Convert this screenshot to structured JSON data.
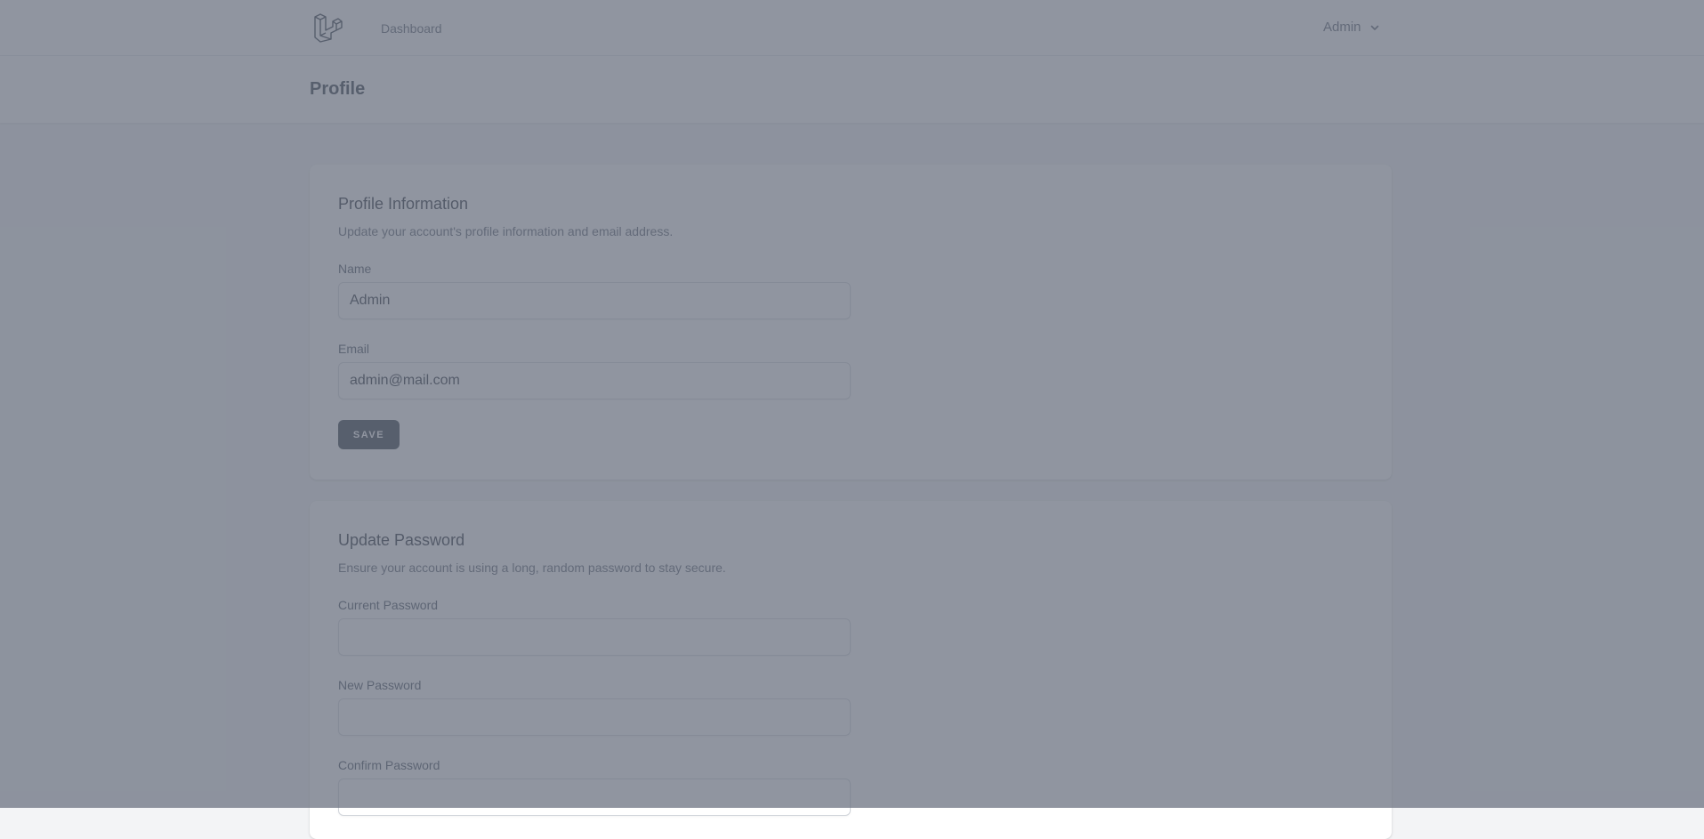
{
  "nav": {
    "logo_icon": "laravel-logo-icon",
    "links": [
      {
        "label": "Dashboard"
      }
    ],
    "user": {
      "name": "Admin",
      "icon": "chevron-down-icon"
    }
  },
  "header": {
    "title": "Profile"
  },
  "profile_section": {
    "title": "Profile Information",
    "description": "Update your account's profile information and email address.",
    "fields": {
      "name": {
        "label": "Name",
        "value": "Admin"
      },
      "email": {
        "label": "Email",
        "value": "admin@mail.com"
      }
    },
    "save_label": "Save"
  },
  "password_section": {
    "title": "Update Password",
    "description": "Ensure your account is using a long, random password to stay secure.",
    "fields": {
      "current_password": {
        "label": "Current Password",
        "value": ""
      },
      "new_password": {
        "label": "New Password",
        "value": ""
      },
      "confirm_password": {
        "label": "Confirm Password",
        "value": ""
      }
    }
  },
  "colors": {
    "page_bg": "#f3f4f6",
    "button_bg": "#1f2937",
    "overlay": "#6b7280"
  }
}
